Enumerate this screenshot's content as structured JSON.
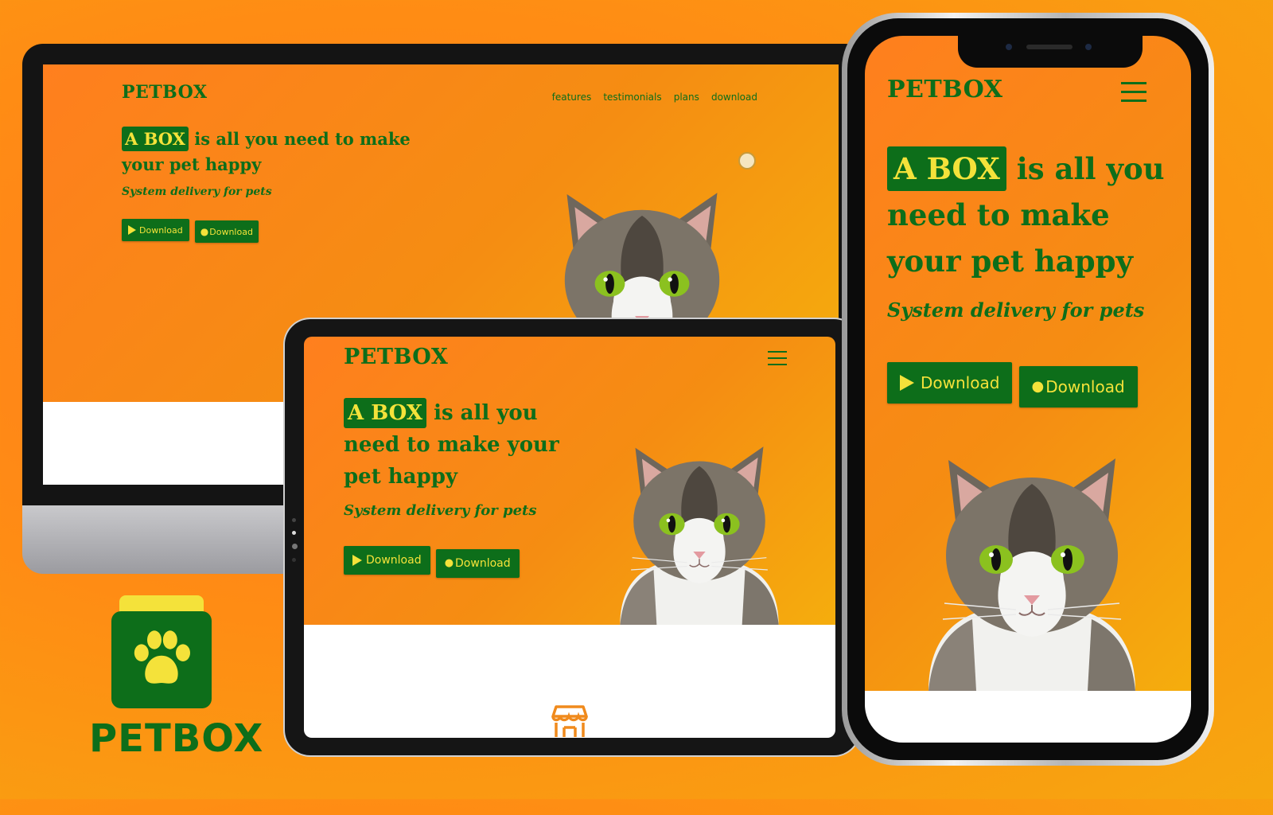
{
  "brand": "PETBOX",
  "nav": [
    "features",
    "testimonials",
    "plans",
    "download"
  ],
  "hero": {
    "highlight": "A BOX",
    "rest": " is all you need to make your pet happy",
    "tablet_rest": " is all you need to make your pet happy",
    "subtitle": "System delivery for pets"
  },
  "buttons": {
    "play": "Download",
    "apple": "Download"
  },
  "colors": {
    "green": "#0d6e1a",
    "yellow": "#f4e23a",
    "orange": "#ff7f1e",
    "amber": "#f5ad0d"
  },
  "icons": [
    "play-store-icon",
    "apple-icon",
    "hamburger-icon",
    "paw-icon",
    "store-icon",
    "screenshot-icon"
  ]
}
